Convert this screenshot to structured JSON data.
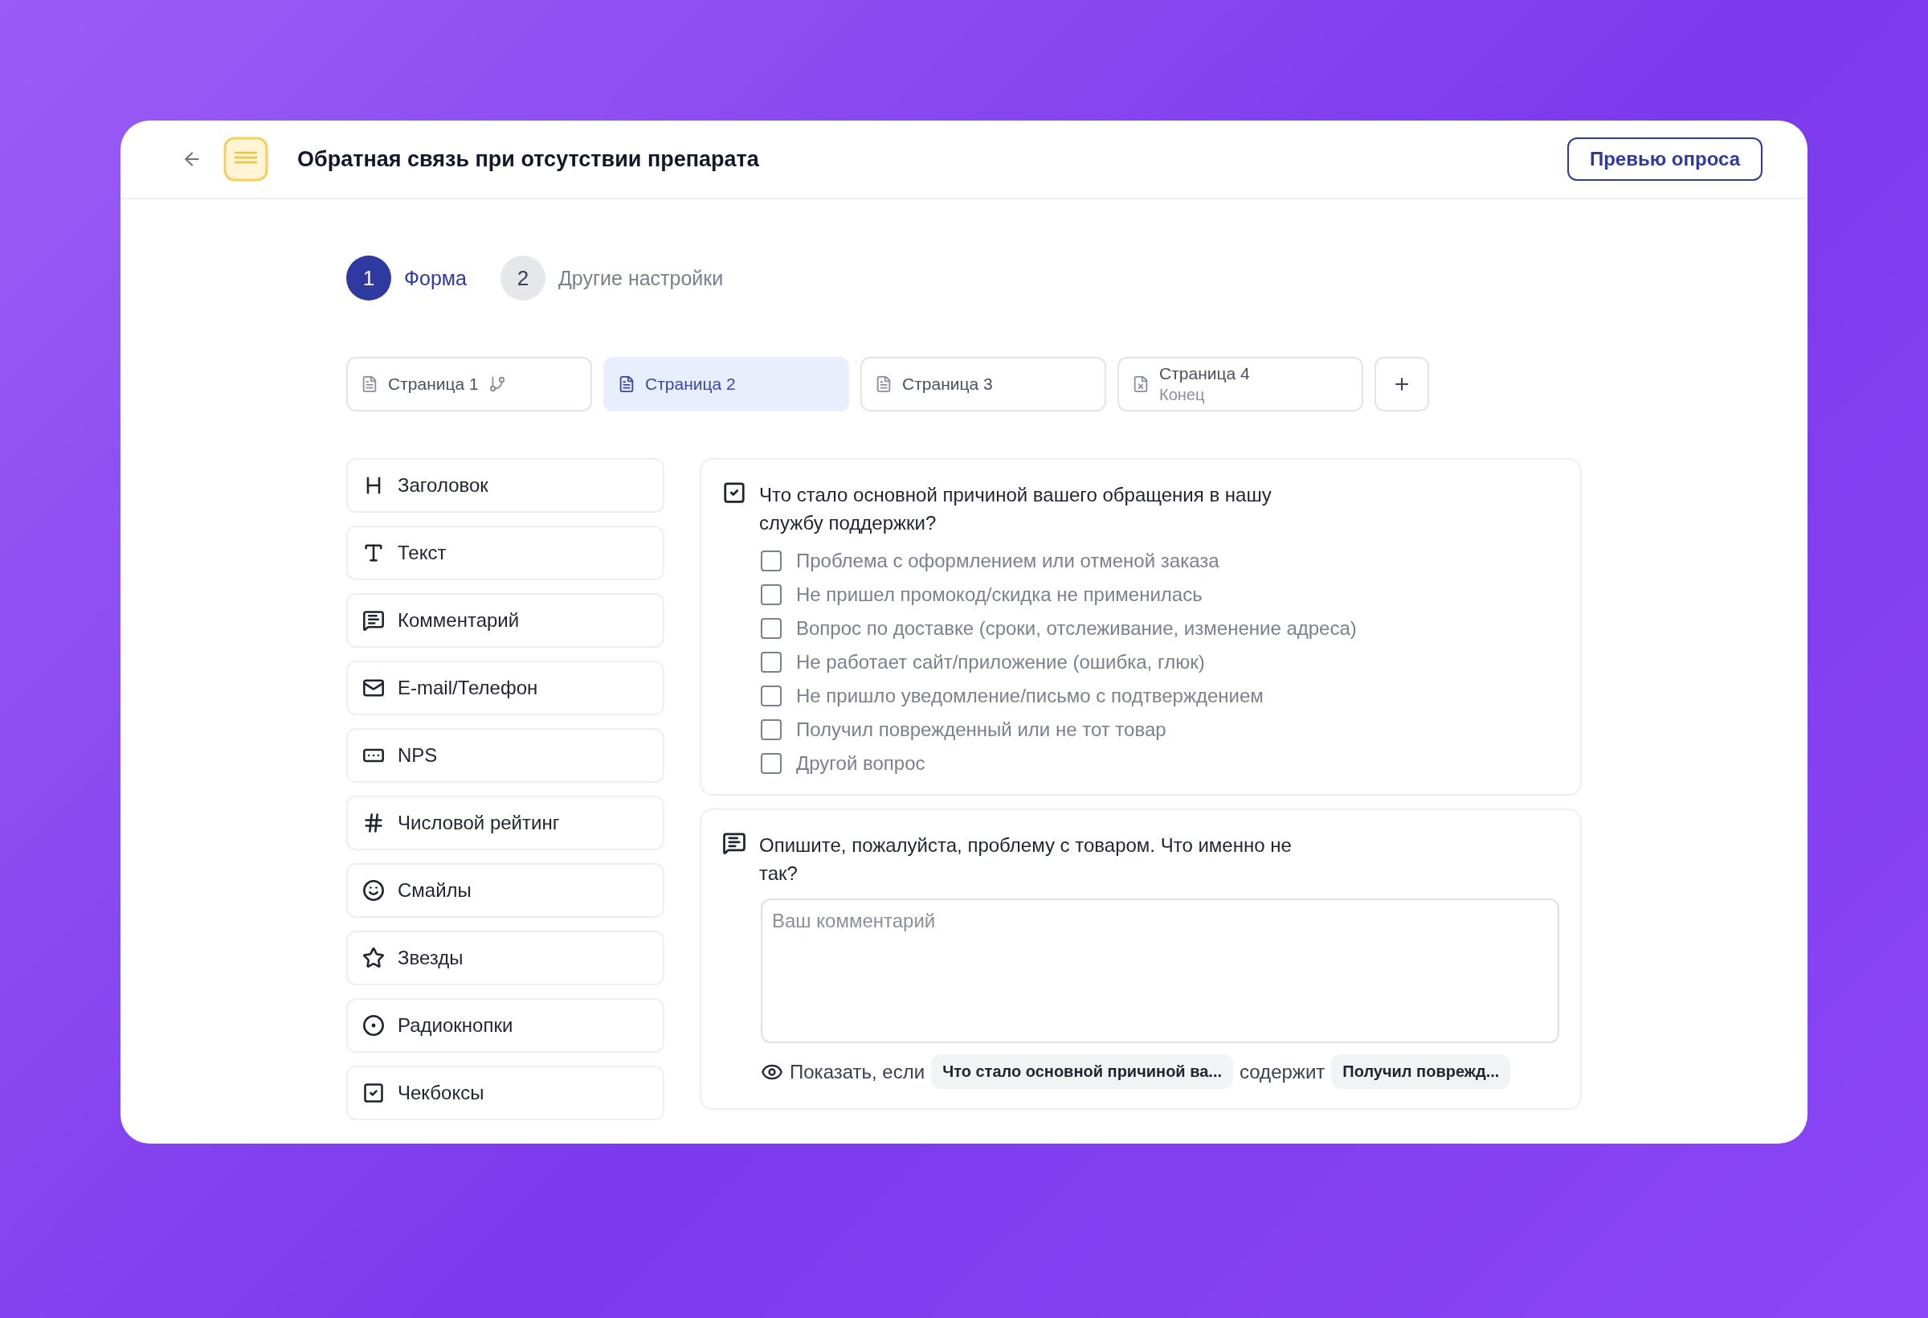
{
  "header": {
    "title": "Обратная связь при отсутствии препарата",
    "preview_button": "Превью опроса"
  },
  "steps": [
    {
      "number": "1",
      "label": "Форма",
      "selected": true
    },
    {
      "number": "2",
      "label": "Другие настройки",
      "selected": false
    }
  ],
  "pages": [
    {
      "kind": "page",
      "label": "Страница 1",
      "selected": false,
      "branching": true
    },
    {
      "kind": "page",
      "label": "Страница 2",
      "selected": true,
      "branching": false
    },
    {
      "kind": "page",
      "label": "Страница 3",
      "selected": false,
      "branching": false
    },
    {
      "kind": "end",
      "label": "Страница 4",
      "subtitle": "Конец",
      "selected": false,
      "branching": false
    }
  ],
  "blocks": [
    {
      "kind": "heading",
      "label": "Заголовок"
    },
    {
      "kind": "text",
      "label": "Текст"
    },
    {
      "kind": "comment",
      "label": "Комментарий"
    },
    {
      "kind": "contact",
      "label": "E-mail/Телефон"
    },
    {
      "kind": "nps",
      "label": "NPS"
    },
    {
      "kind": "rating",
      "label": "Числовой рейтинг"
    },
    {
      "kind": "smiles",
      "label": "Смайлы"
    },
    {
      "kind": "stars",
      "label": "Звезды"
    },
    {
      "kind": "radio",
      "label": "Радиокнопки"
    },
    {
      "kind": "checkbox",
      "label": "Чекбоксы"
    }
  ],
  "questions": [
    {
      "kind": "checkboxes",
      "title": "Что стало основной причиной вашего обращения в нашу службу поддержки?",
      "options": [
        {
          "label": "Проблема с оформлением или отменой заказа",
          "checked": false
        },
        {
          "label": "Не пришел промокод/скидка не применилась",
          "checked": false
        },
        {
          "label": "Вопрос по доставке (сроки, отслеживание, изменение адреса)",
          "checked": false
        },
        {
          "label": "Не работает сайт/приложение (ошибка, глюк)",
          "checked": false
        },
        {
          "label": "Не пришло уведомление/письмо с подтверждением",
          "checked": false
        },
        {
          "label": "Получил поврежденный или не тот товар",
          "checked": false
        },
        {
          "label": "Другой вопрос",
          "checked": false
        }
      ]
    },
    {
      "kind": "comment",
      "title": "Опишите, пожалуйста, проблему с товаром. Что именно не так?",
      "placeholder": "Ваш комментарий",
      "condition": {
        "prefix": "Показать, если",
        "question": "Что стало основной причиной ва...",
        "operator": "содержит",
        "value": "Получил поврежд..."
      }
    }
  ]
}
